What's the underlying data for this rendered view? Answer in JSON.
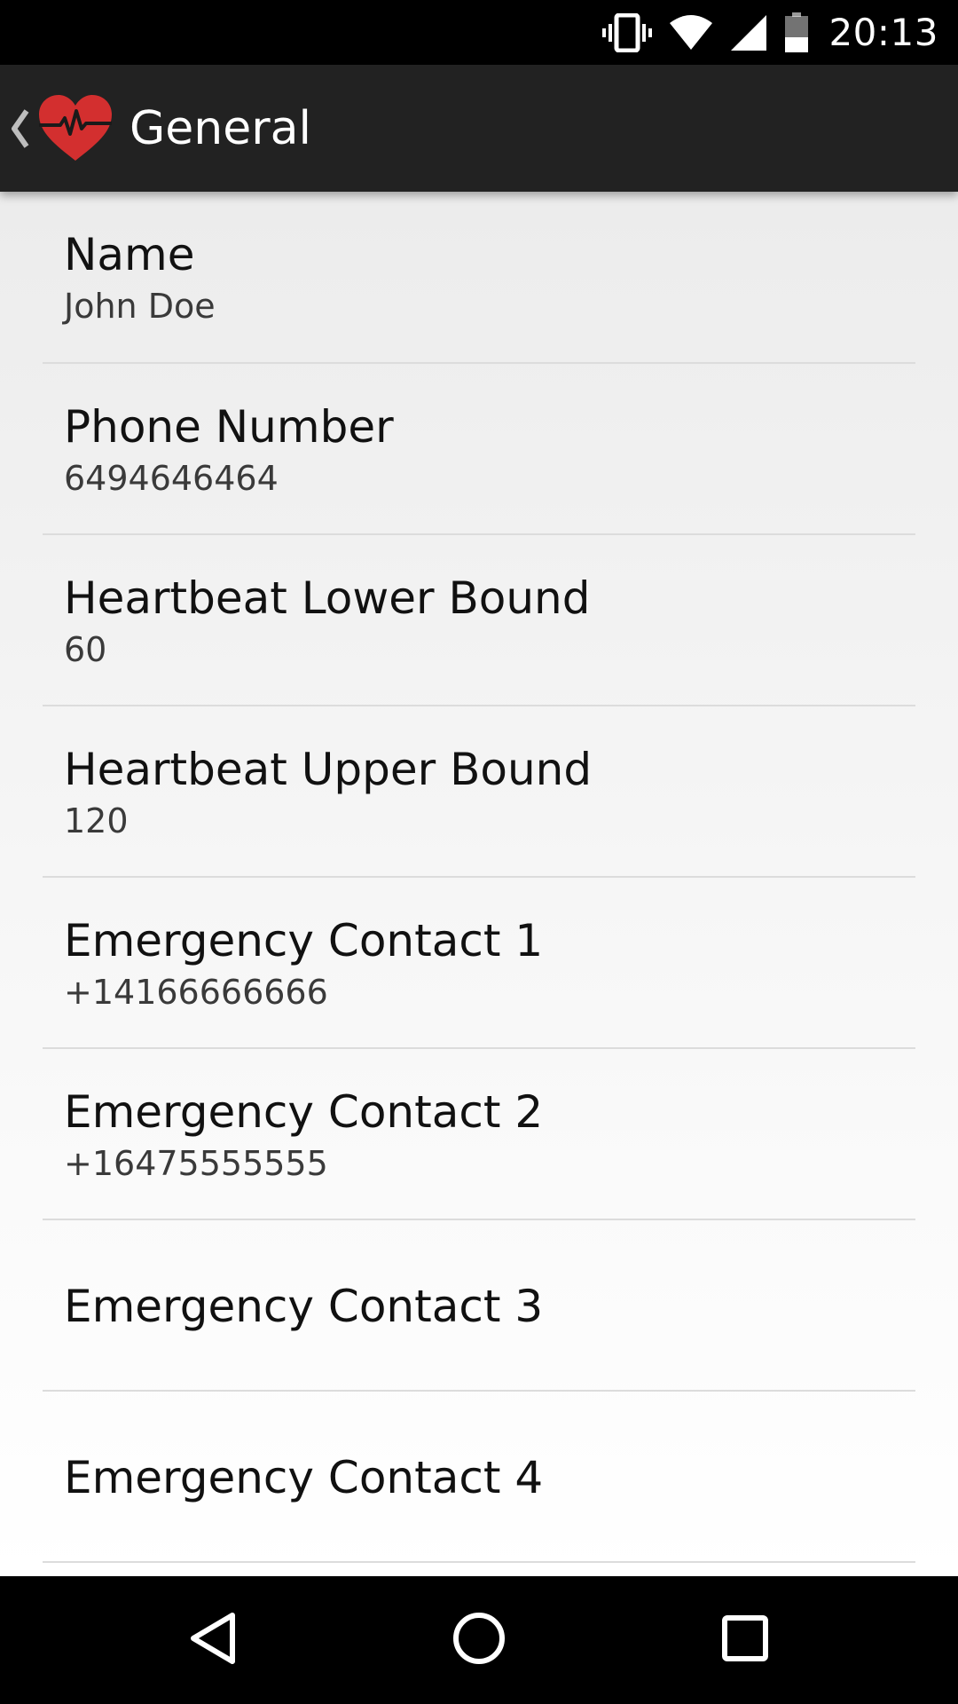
{
  "status_bar": {
    "time": "20:13",
    "icons": [
      "vibrate-icon",
      "wifi-icon",
      "cellular-signal-icon",
      "battery-icon"
    ]
  },
  "action_bar": {
    "title": "General",
    "icons": [
      "back-chevron-icon",
      "heart-pulse-logo-icon"
    ],
    "colors": {
      "background": "#222222",
      "logo": "#d32f2f"
    }
  },
  "preferences": [
    {
      "title": "Name",
      "summary": "John Doe"
    },
    {
      "title": "Phone Number",
      "summary": "6494646464"
    },
    {
      "title": "Heartbeat Lower Bound",
      "summary": "60"
    },
    {
      "title": "Heartbeat Upper Bound",
      "summary": "120"
    },
    {
      "title": "Emergency Contact 1",
      "summary": "+14166666666"
    },
    {
      "title": "Emergency Contact 2",
      "summary": "+16475555555"
    },
    {
      "title": "Emergency Contact 3",
      "summary": ""
    },
    {
      "title": "Emergency Contact 4",
      "summary": ""
    }
  ],
  "nav_bar": {
    "icons": [
      "nav-back-icon",
      "nav-home-icon",
      "nav-recents-icon"
    ]
  }
}
